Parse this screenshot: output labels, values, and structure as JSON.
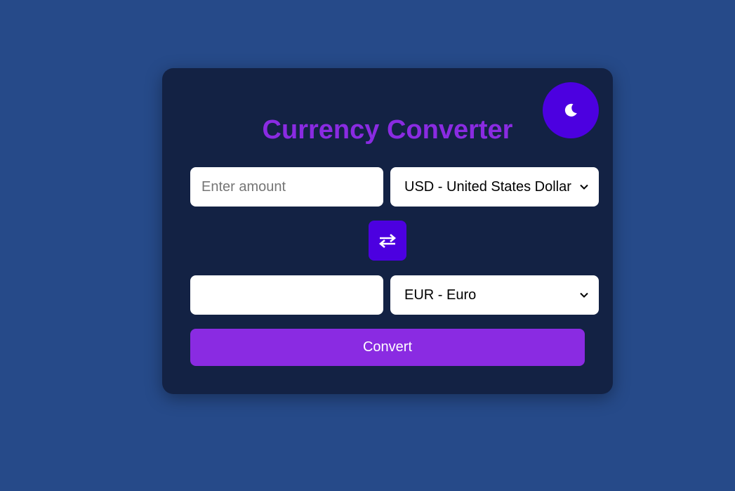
{
  "app": {
    "title": "Currency Converter"
  },
  "theme_toggle": {
    "icon": "moon-icon"
  },
  "amount": {
    "value": "",
    "placeholder": "Enter amount"
  },
  "from_currency": {
    "selected": "USD - United States Dollar"
  },
  "swap": {
    "icon": "swap-arrows-icon"
  },
  "result": {
    "value": "",
    "placeholder": ""
  },
  "to_currency": {
    "selected": "EUR - Euro"
  },
  "convert_button": {
    "label": "Convert"
  },
  "colors": {
    "page_background": "#264a89",
    "card_background": "#132244",
    "title": "#8a2be2",
    "toggle_and_swap": "#4c00e0",
    "convert_button": "#8a2be2"
  }
}
